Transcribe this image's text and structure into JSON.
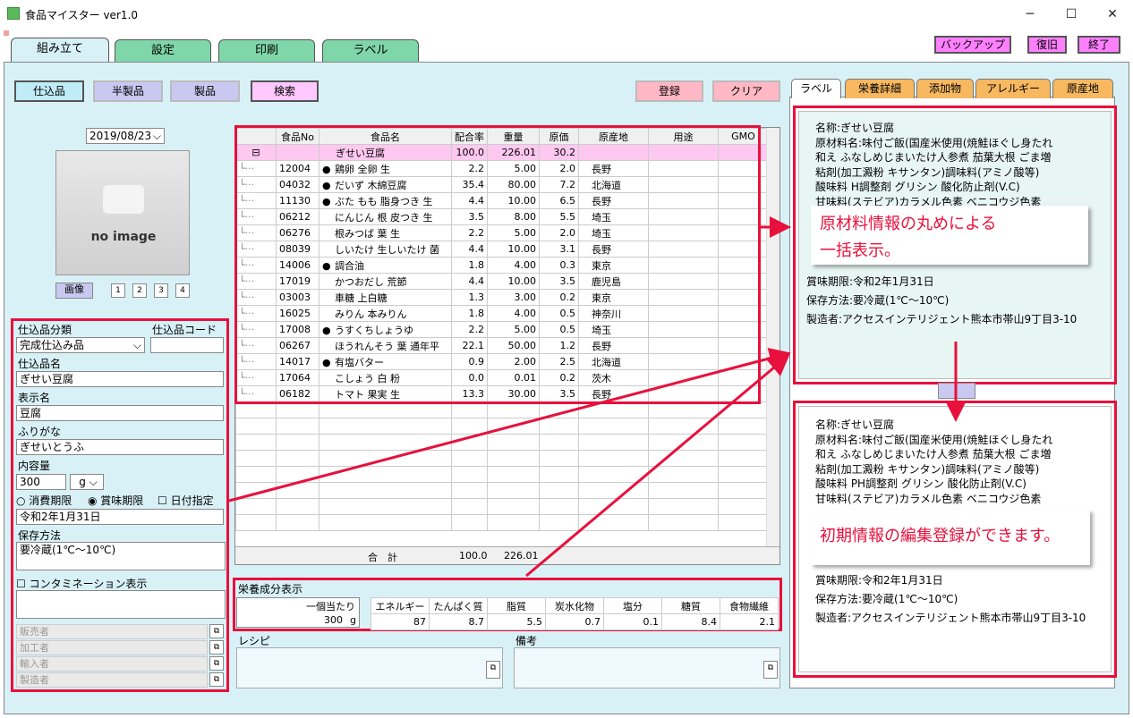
{
  "window": {
    "title": "食品マイスター ver1.0",
    "min": "─",
    "max": "☐",
    "close": "✕"
  },
  "main_tabs": [
    "組み立て",
    "設定",
    "印刷",
    "ラベル"
  ],
  "top_buttons": {
    "backup": "バックアップ",
    "restore": "復旧",
    "exit": "終了"
  },
  "toolbar": {
    "shikomi": "仕込品",
    "hanseihin": "半製品",
    "seihin": "製品",
    "search": "検索",
    "register": "登録",
    "clear": "クリア"
  },
  "date": "2019/08/23",
  "image": {
    "placeholder": "no image",
    "button": "画像",
    "pages": [
      "1",
      "2",
      "3",
      "4"
    ]
  },
  "form": {
    "category_label": "仕込品分類",
    "code_label": "仕込品コード",
    "category_value": "完成仕込み品",
    "name_label": "仕込品名",
    "name_value": "ぎせい豆腐",
    "display_label": "表示名",
    "display_value": "豆腐",
    "kana_label": "ふりがな",
    "kana_value": "ぎせいとうふ",
    "volume_label": "内容量",
    "volume_value": "300",
    "volume_unit": "g",
    "expiry_options": [
      "消費期限",
      "賞味期限",
      "日付指定"
    ],
    "expiry_value": "令和2年1月31日",
    "storage_label": "保存方法",
    "storage_value": "要冷蔵(1℃〜10℃)",
    "contamination_label": "コンタミネーション表示",
    "roles": [
      "販売者",
      "加工者",
      "輸入者",
      "製造者"
    ]
  },
  "grid": {
    "headers": [
      "",
      "食品No",
      "食品名",
      "配合率",
      "重量",
      "原価",
      "原産地",
      "用途",
      "GMO"
    ],
    "parent": {
      "name": "ぎせい豆腐",
      "rate": "100.0",
      "weight": "226.01",
      "cost": "30.2"
    },
    "rows": [
      {
        "no": "12004",
        "dot": true,
        "name": "鶏卵 全卵 生",
        "rate": "2.2",
        "weight": "5.00",
        "cost": "2.0",
        "origin": "長野"
      },
      {
        "no": "04032",
        "dot": true,
        "name": "だいず 木綿豆腐",
        "rate": "35.4",
        "weight": "80.00",
        "cost": "7.2",
        "origin": "北海道"
      },
      {
        "no": "11130",
        "dot": true,
        "name": "ぶた もも 脂身つき 生",
        "rate": "4.4",
        "weight": "10.00",
        "cost": "6.5",
        "origin": "長野"
      },
      {
        "no": "06212",
        "dot": false,
        "name": "にんじん 根 皮つき 生",
        "rate": "3.5",
        "weight": "8.00",
        "cost": "5.5",
        "origin": "埼玉"
      },
      {
        "no": "06276",
        "dot": false,
        "name": "根みつば 葉 生",
        "rate": "2.2",
        "weight": "5.00",
        "cost": "2.0",
        "origin": "埼玉"
      },
      {
        "no": "08039",
        "dot": false,
        "name": "しいたけ 生しいたけ 菌",
        "rate": "4.4",
        "weight": "10.00",
        "cost": "3.1",
        "origin": "長野"
      },
      {
        "no": "14006",
        "dot": true,
        "name": "調合油",
        "rate": "1.8",
        "weight": "4.00",
        "cost": "0.3",
        "origin": "東京"
      },
      {
        "no": "17019",
        "dot": false,
        "name": "かつおだし 荒節",
        "rate": "4.4",
        "weight": "10.00",
        "cost": "3.5",
        "origin": "鹿児島"
      },
      {
        "no": "03003",
        "dot": false,
        "name": "車糖 上白糖",
        "rate": "1.3",
        "weight": "3.00",
        "cost": "0.2",
        "origin": "東京"
      },
      {
        "no": "16025",
        "dot": false,
        "name": "みりん 本みりん",
        "rate": "1.8",
        "weight": "4.00",
        "cost": "0.5",
        "origin": "神奈川"
      },
      {
        "no": "17008",
        "dot": true,
        "name": "うすくちしょうゆ",
        "rate": "2.2",
        "weight": "5.00",
        "cost": "0.5",
        "origin": "埼玉"
      },
      {
        "no": "06267",
        "dot": false,
        "name": "ほうれんそう 葉 通年平",
        "rate": "22.1",
        "weight": "50.00",
        "cost": "1.2",
        "origin": "長野"
      },
      {
        "no": "14017",
        "dot": true,
        "name": "有塩バター",
        "rate": "0.9",
        "weight": "2.00",
        "cost": "2.5",
        "origin": "北海道"
      },
      {
        "no": "17064",
        "dot": false,
        "name": "こしょう 白 粉",
        "rate": "0.0",
        "weight": "0.01",
        "cost": "0.2",
        "origin": "茨木"
      },
      {
        "no": "06182",
        "dot": false,
        "name": "トマト 果実 生",
        "rate": "13.3",
        "weight": "30.00",
        "cost": "3.5",
        "origin": "長野"
      }
    ],
    "total_label": "合　計",
    "total_rate": "100.0",
    "total_weight": "226.01"
  },
  "nutrition": {
    "title": "栄養成分表示",
    "per_label": "一個当たり",
    "per_value": "300",
    "per_unit": "g",
    "headers": [
      "エネルギー",
      "たんぱく質",
      "脂質",
      "炭水化物",
      "塩分",
      "糖質",
      "食物繊維"
    ],
    "values": [
      "87",
      "8.7",
      "5.5",
      "0.7",
      "0.1",
      "8.4",
      "2.1"
    ]
  },
  "recipe_label": "レシピ",
  "notes_label": "備考",
  "label_tabs": [
    "ラベル",
    "栄養詳細",
    "添加物",
    "アレルギー",
    "原産地"
  ],
  "label_top": {
    "lines": [
      "名称:ぎせい豆腐",
      "原材料名:味付ご飯(国産米使用(焼鮭ほぐし身たれ",
      "和え ふなしめじまいたけ人参煮 茄葉大根 ごま増",
      "粘剤(加工澱粉 キサンタン)調味料(アミノ酸等)",
      "酸味料 H調整剤 グリシン 酸化防止剤(V.C)",
      "甘味料(ステビア)カラメル色素 ベニコウジ色素"
    ],
    "bottom": [
      "賞味期限:令和2年1月31日",
      "保存方法:要冷蔵(1℃〜10℃)",
      "製造者:アクセスインテリジェント熊本市帯山9丁目3-10"
    ]
  },
  "label_bottom": {
    "lines": [
      "名称:ぎせい豆腐",
      "原材料名:味付ご飯(国産米使用(焼鮭ほぐし身たれ",
      "和え ふなしめじまいたけ人参煮 茄葉大根 ごま増",
      "粘剤(加工澱粉 キサンタン)調味料(アミノ酸等)",
      "酸味料 PH調整剤 グリシン 酸化防止剤(V.C)",
      "甘味料(ステビア)カラメル色素 ベニコウジ色素"
    ],
    "bottom": [
      "賞味期限:令和2年1月31日",
      "保存方法:要冷蔵(1℃〜10℃)",
      "製造者:アクセスインテリジェント熊本市帯山9丁目3-10"
    ]
  },
  "callouts": {
    "top": [
      "原材料情報の丸めによる",
      "一括表示。"
    ],
    "bottom": "初期情報の編集登録ができます。"
  }
}
